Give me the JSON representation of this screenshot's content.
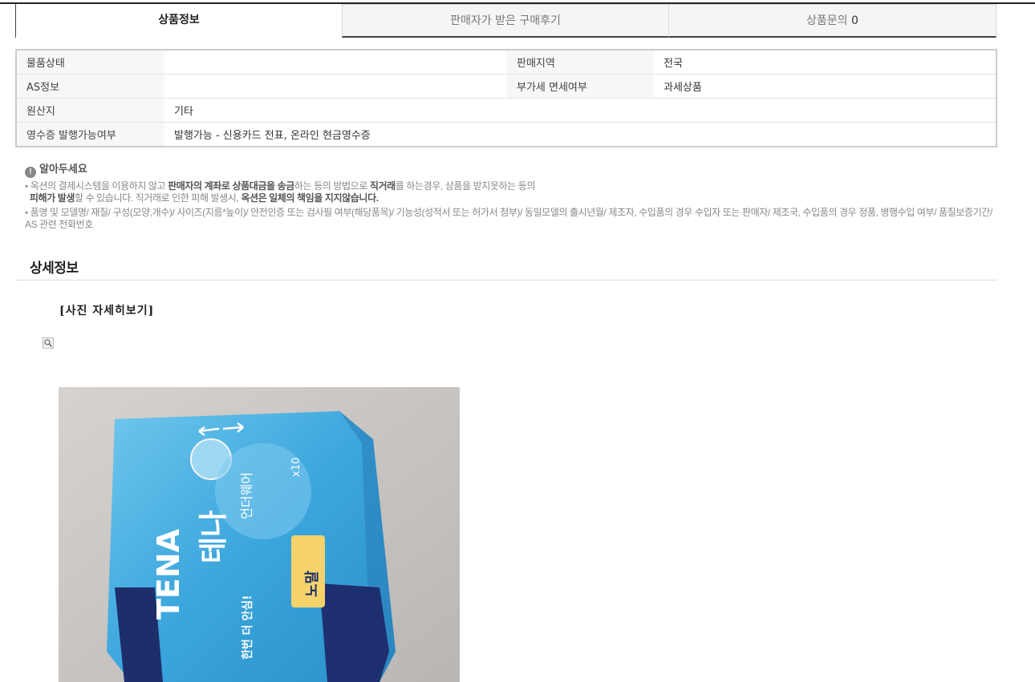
{
  "tabs": [
    {
      "label": "상품정보"
    },
    {
      "label": "판매자가 받은 구매후기"
    },
    {
      "label": "상품문의",
      "count": "0"
    }
  ],
  "info_table": {
    "rows": [
      {
        "l1": "물품상태",
        "v1": "",
        "l2": "판매지역",
        "v2": "전국"
      },
      {
        "l1": "AS정보",
        "v1": "",
        "l2": "부가세 면세여부",
        "v2": "과세상품"
      },
      {
        "l1": "원산지",
        "v1": "기타"
      },
      {
        "l1": "영수증 발행가능여부",
        "v1": "발행가능 - 신용카드 전표, 온라인 현금영수증"
      }
    ]
  },
  "notice": {
    "title": "알아두세요",
    "line1": {
      "a": "옥션의 결제시스템을 이용하지 않고 ",
      "b": "판매자의 계좌로 상품대금을 송금",
      "c": "하는 등의 방법으로 ",
      "d": "직거래",
      "e": "를 하는경우, 상품을 받지못하는 등의",
      "f": "피해가 발생",
      "g": "할 수 있습니다. 직거래로 인한 피해 발생시, ",
      "h": "옥션은 일체의 책임을 지지않습니다."
    },
    "line2": "품명 및 모델명/ 재질/ 구성(모양,개수)/ 사이즈(지름*높이)/ 안전인증 또는 검사필 여부(해당품목)/ 기능성(성적서 또는 허가서 첨부)/ 동일모델의 출시년월/ 제조자, 수입품의 경우 수입자 또는 판매자/ 제조국, 수입품의 경우 정품, 병행수입 여부/ 품질보증기간/ AS 관련 전화번호"
  },
  "section_title": "상세정보",
  "photo_link": "[사진 자세히보기]",
  "photo": {
    "brand": "TENA",
    "product_name": "테나",
    "subtitle": "언더웨어",
    "size_label": "노말",
    "count_label": "x10",
    "tagline": "한번 더 안심!"
  },
  "icons": {
    "notice": "info-circle-icon",
    "zoom": "magnifier-icon"
  }
}
